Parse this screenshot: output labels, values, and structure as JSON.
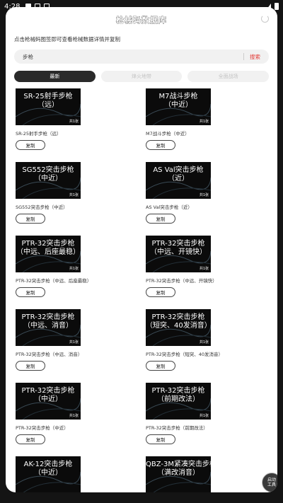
{
  "status": {
    "time": "4:28"
  },
  "header": {
    "title": "枪械码数据库"
  },
  "subtitle": "点击枪械码图签即可查看枪械数据详情并复制",
  "search": {
    "query": "步枪",
    "button": "搜索"
  },
  "tabs": [
    {
      "label": "最新"
    },
    {
      "label": "烽火地带"
    },
    {
      "label": "全面战场"
    }
  ],
  "copy_label": "复制",
  "cards": [
    {
      "thumb_line1": "SR-25射手步枪",
      "thumb_line2": "（远）",
      "thumb_badge": "共1张",
      "caption": "SR-25射手步枪（远）"
    },
    {
      "thumb_line1": "M7战斗步枪",
      "thumb_line2": "（中近）",
      "thumb_badge": "共1张",
      "caption": "M7战斗步枪（中近）"
    },
    {
      "thumb_line1": "SG552突击步枪",
      "thumb_line2": "（中近）",
      "thumb_badge": "共1张",
      "caption": "SG552突击步枪（中近）"
    },
    {
      "thumb_line1": "AS Val突击步枪",
      "thumb_line2": "（近）",
      "thumb_badge": "共1张",
      "caption": "AS Val突击步枪（近）"
    },
    {
      "thumb_line1": "PTR-32突击步枪",
      "thumb_line2": "（中远、后座最稳）",
      "thumb_badge": "共1张",
      "caption": "PTR-32突击步枪（中远、后座最稳）"
    },
    {
      "thumb_line1": "PTR-32突击步枪",
      "thumb_line2": "（中远、开镜快）",
      "thumb_badge": "共1张",
      "caption": "PTR-32突击步枪（中远、开镜快）"
    },
    {
      "thumb_line1": "PTR-32突击步枪",
      "thumb_line2": "（中远、消音）",
      "thumb_badge": "共1张",
      "caption": "PTR-32突击步枪（中远、消音）"
    },
    {
      "thumb_line1": "PTR-32突击步枪",
      "thumb_line2": "（短突、40发消音）",
      "thumb_badge": "共1张",
      "caption": "PTR-32突击步枪（短突、40发消音）"
    },
    {
      "thumb_line1": "PTR-32突击步枪",
      "thumb_line2": "（中近）",
      "thumb_badge": "共1张",
      "caption": "PTR-32突击步枪（中近）"
    },
    {
      "thumb_line1": "PTR-32突击步枪",
      "thumb_line2": "（前期改法）",
      "thumb_badge": "共1张",
      "caption": "PTR-32突击步枪（前期改法）"
    },
    {
      "thumb_line1": "AK-12突击步枪",
      "thumb_line2": "（中近）",
      "thumb_badge": "",
      "caption": ""
    },
    {
      "thumb_line1": "QBZ-3M紧凑突击步枪",
      "thumb_line2": "（满改消音）",
      "thumb_badge": "",
      "caption": ""
    }
  ],
  "fab": {
    "line1": "启动",
    "line2": "工具"
  }
}
